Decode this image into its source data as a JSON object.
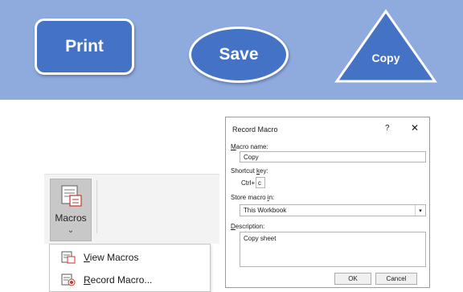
{
  "shapes": {
    "print_label": "Print",
    "save_label": "Save",
    "copy_label": "Copy"
  },
  "ribbon": {
    "macros_label": "Macros",
    "caret": "⌄"
  },
  "menu": {
    "items": [
      {
        "pre": "",
        "key": "V",
        "post": "iew Macros",
        "icon": "view-macros-icon"
      },
      {
        "pre": "",
        "key": "R",
        "post": "ecord Macro...",
        "icon": "record-macro-icon"
      }
    ]
  },
  "dialog": {
    "title": "Record Macro",
    "help": "?",
    "close": "✕",
    "macro_name_label": {
      "pre": "",
      "key": "M",
      "post": "acro name:"
    },
    "macro_name_value": "Copy",
    "shortcut_label": {
      "pre": "Shortcut ",
      "key": "k",
      "post": "ey:"
    },
    "ctrl_label": "Ctrl+",
    "shortcut_value": "c",
    "store_label": {
      "pre": "Store macro ",
      "key": "i",
      "post": "n:"
    },
    "store_value": "This Workbook",
    "description_label": {
      "pre": "",
      "key": "D",
      "post": "escription:"
    },
    "description_value": "Copy sheet",
    "ok_label": "OK",
    "cancel_label": "Cancel"
  },
  "colors": {
    "banner": "#8faadc",
    "shape_fill": "#4472c4",
    "shape_border": "#ffffff"
  }
}
